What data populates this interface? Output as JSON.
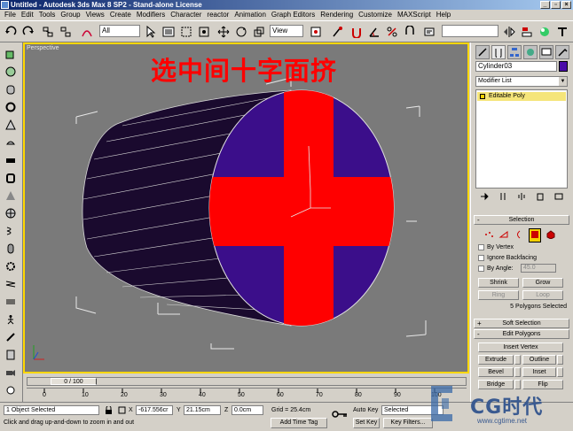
{
  "titlebar": {
    "title": "Untitled - Autodesk 3ds Max 8 SP2 - Stand-alone License"
  },
  "menu": [
    "File",
    "Edit",
    "Tools",
    "Group",
    "Views",
    "Create",
    "Modifiers",
    "Character",
    "reactor",
    "Animation",
    "Graph Editors",
    "Rendering",
    "Customize",
    "MAXScript",
    "Help"
  ],
  "toolbar": {
    "selection_filter": "All",
    "ref_coord": "View"
  },
  "viewport": {
    "label": "Perspective",
    "overlay_text": "选中间十字面挤"
  },
  "panel": {
    "object_name": "Cylinder03",
    "modifier_list": "Modifier List",
    "stack_item": "Editable Poly",
    "selection": {
      "title": "Selection",
      "by_vertex": "By Vertex",
      "ignore_backfacing": "Ignore Backfacing",
      "by_angle": "By Angle:",
      "angle_value": "45.0",
      "shrink": "Shrink",
      "grow": "Grow",
      "ring": "Ring",
      "loop": "Loop",
      "status": "5 Polygons Selected"
    },
    "soft_selection": "Soft Selection",
    "edit_polygons": {
      "title": "Edit Polygons",
      "insert_vertex": "Insert Vertex",
      "extrude": "Extrude",
      "outline": "Outline",
      "bevel": "Bevel",
      "inset": "Inset",
      "bridge": "Bridge",
      "flip": "Flip"
    }
  },
  "timeline": {
    "frame": "0 / 100",
    "ticks": [
      "0",
      "10",
      "20",
      "30",
      "40",
      "50",
      "60",
      "70",
      "80",
      "90",
      "100"
    ]
  },
  "status": {
    "selected": "1 Object Selected",
    "prompt": "Click and drag up-and-down to zoom in and out",
    "x_label": "X",
    "x_value": "-617.556cr",
    "y_label": "Y",
    "y_value": "21.15cm",
    "z_label": "Z",
    "z_value": "0.0cm",
    "grid": "Grid = 25.4cm",
    "add_time_tag": "Add Time Tag",
    "auto_key": "Auto Key",
    "set_key": "Set Key",
    "selected_dropdown": "Selected",
    "key_filters": "Key Filters..."
  },
  "watermark": {
    "text": "CG时代",
    "url": "www.cgtime.net"
  },
  "colors": {
    "object": "#4a0ca8",
    "selection": "#ff0000",
    "viewport_border": "#ffd700"
  }
}
